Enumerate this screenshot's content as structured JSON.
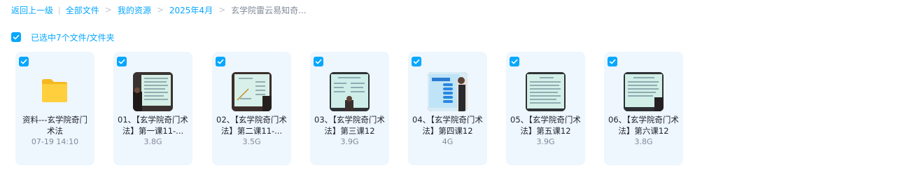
{
  "breadcrumb": {
    "back": "返回上一级",
    "items": [
      "全部文件",
      "我的资源",
      "2025年4月",
      "玄学院雷云易知奇..."
    ]
  },
  "selection": {
    "text": "已选中7个文件/文件夹"
  },
  "files": [
    {
      "type": "folder",
      "name": "资料---玄学院奇门术法",
      "meta": "07-19 14:10",
      "selected": true
    },
    {
      "type": "video",
      "name": "01、【玄学院奇门术法】第一课11-...",
      "meta": "3.8G",
      "selected": true
    },
    {
      "type": "video",
      "name": "02、【玄学院奇门术法】第二课11-...",
      "meta": "3.5G",
      "selected": true
    },
    {
      "type": "video",
      "name": "03、【玄学院奇门术法】第三课12",
      "meta": "3.9G",
      "selected": true
    },
    {
      "type": "video",
      "name": "04、【玄学院奇门术法】第四课12",
      "meta": "4G",
      "selected": true
    },
    {
      "type": "video",
      "name": "05、【玄学院奇门术法】第五课12",
      "meta": "3.9G",
      "selected": true
    },
    {
      "type": "video",
      "name": "06、【玄学院奇门术法】第六课12",
      "meta": "3.8G",
      "selected": true
    }
  ],
  "colors": {
    "accent": "#06a7ff",
    "card_bg": "#eef6fe",
    "meta_text": "#818999",
    "folder": "#ffc933"
  }
}
